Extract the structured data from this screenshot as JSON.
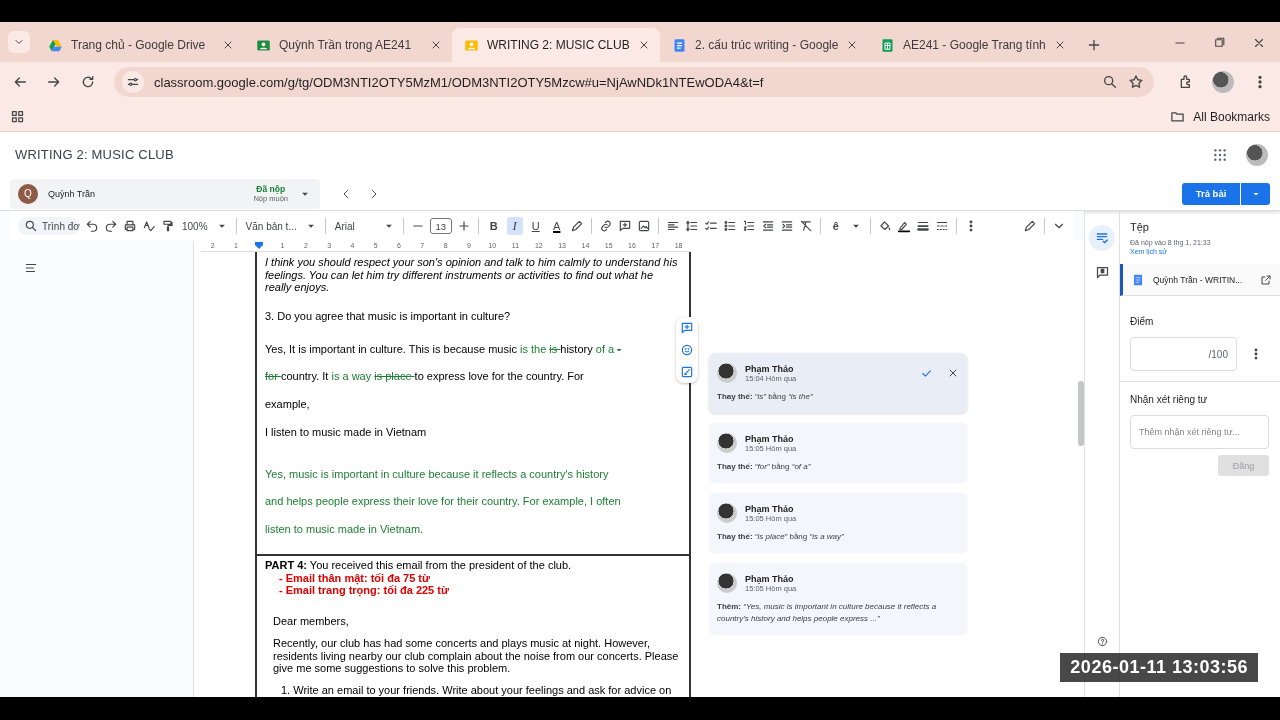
{
  "browser": {
    "tabs": [
      {
        "title": "Trang chủ - Google Drive",
        "selected": false
      },
      {
        "title": "Quỳnh Trần trong AE241",
        "selected": false
      },
      {
        "title": "WRITING 2: MUSIC CLUB",
        "selected": true
      },
      {
        "title": "2. cấu trúc writing - Google",
        "selected": false
      },
      {
        "title": "AE241 - Google Trang tính",
        "selected": false
      }
    ],
    "url": "classroom.google.com/g/tg/ODM3NTI2OTY5MzM1/ODM3NTI2OTY5Mzcw#u=NjAwNDk1NTEwODA4&t=f",
    "bookmarks_label": "All Bookmarks"
  },
  "header": {
    "title": "WRITING 2: MUSIC CLUB"
  },
  "student": {
    "initial": "Q",
    "name": "Quỳnh Trần",
    "status": "Đã nộp",
    "note": "Nộp muộn",
    "return_button": "Trả bài"
  },
  "toolbar": {
    "menu_search": "Trình đơ",
    "zoom": "100%",
    "style": "Văn bản t...",
    "font": "Arial",
    "font_size": "13",
    "format_buttons": [
      {
        "label": "B",
        "selected": false
      },
      {
        "label": "I",
        "selected": true
      },
      {
        "label": "U",
        "selected": false
      },
      {
        "label": "A",
        "selected": false
      }
    ],
    "input_tool": "ê"
  },
  "ruler": [
    "2",
    "1",
    "1",
    "2",
    "3",
    "4",
    "5",
    "6",
    "7",
    "8",
    "9",
    "10",
    "11",
    "12",
    "13",
    "14",
    "15",
    "16",
    "17",
    "18"
  ],
  "document": {
    "italic_paragraph": "I think you should respect your son's opinion and talk to him calmly to understand his feelings. You can let him try different instruments or activities to find out what he really enjoys.",
    "question": "3. Do you agree that music is important in culture?",
    "answer": [
      {
        "text": "Yes, It is important in culture. This is because music ",
        "kind": "normal"
      },
      {
        "text": "is the ",
        "kind": "insert"
      },
      {
        "text": "is ",
        "kind": "delete"
      },
      {
        "text": "history ",
        "kind": "normal"
      },
      {
        "text": "of a ",
        "kind": "insert"
      },
      {
        "text": "- for ",
        "kind": "delete"
      },
      {
        "text": "country. It ",
        "kind": "normal"
      },
      {
        "text": "is a way ",
        "kind": "insert"
      },
      {
        "text": "is place ",
        "kind": "delete"
      },
      {
        "text": "to express love for the country. For example,",
        "kind": "normal"
      },
      {
        "text": "I listen to music made in Vietnam",
        "kind": "break"
      }
    ],
    "suggested_paragraph": "Yes, music is important in culture because it reflects a country's history and helps people express their love for their country. For example, I often listen to music made in Vietnam.",
    "part_heading": "**PART 4:** You received this email from the president of the club.",
    "requirements": [
      "- Email thân mật: tối đa 75 từ",
      "- Email trang trọng: tối đa 225 từ"
    ],
    "greeting": "Dear members,",
    "email_body": "Recently, our club has had some concerts and plays music at night. However, residents living nearby our club complain about the noise from our concerts. Please give me some suggestions to solve this problem.",
    "task": "1. Write an email to your friends. Write about your feelings and ask for advice on"
  },
  "comments": [
    {
      "author": "Phạm Thảo",
      "time": "15:04 Hôm qua",
      "text": "**Thay thế:** *“is”* bằng *“is the”*",
      "selected": true
    },
    {
      "author": "Phạm Thảo",
      "time": "15:05 Hôm qua",
      "text": "**Thay thế:** *“for”* bằng *“of a”*",
      "selected": false
    },
    {
      "author": "Phạm Thảo",
      "time": "15:05 Hôm qua",
      "text": "**Thay thế:** *“is place”* bằng *“is a way”*",
      "selected": false
    },
    {
      "author": "Phạm Thảo",
      "time": "15:05 Hôm qua",
      "text": "**Thêm:** *“Yes, music is important in culture because it reflects a country’s history and helps people express ...”*",
      "selected": false
    }
  ],
  "panel": {
    "files_title": "Tệp",
    "submitted": "Đã nộp vào 8 thg 1, 21:33",
    "history_link": "Xem lịch sử",
    "file_name": "Quỳnh Trần - WRITIN...",
    "grade_label": "Điểm",
    "grade_suffix": "/100",
    "private_label": "Nhận xét riêng tư",
    "private_placeholder": "Thêm nhận xét riêng tư...",
    "post_button": "Đăng",
    "post_disabled": true
  },
  "timestamp": "2026-01-11 13:03:56"
}
